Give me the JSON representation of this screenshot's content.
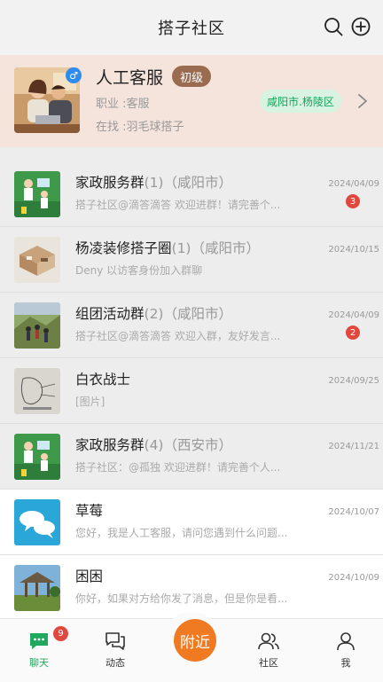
{
  "header": {
    "title": "搭子社区",
    "search_icon": "search-icon",
    "add_icon": "plus-circle-icon"
  },
  "profile": {
    "name": "人工客服",
    "level": "初级",
    "gender_icon": "male-icon",
    "job": "职业 :客服",
    "seeking": "在找 :羽毛球搭子",
    "location": "咸阳市.杨陵区"
  },
  "chats": [
    {
      "title": "家政服务群",
      "suffix": "(1)（咸阳市）",
      "message": "搭子社区@滴答滴答 欢迎进群！请完善个...",
      "date": "2024/04/09",
      "badge": "3"
    },
    {
      "title": "杨凌装修搭子圈",
      "suffix": "(1)（咸阳市）",
      "message": "Deny 以访客身份加入群聊",
      "date": "2024/10/15",
      "badge": ""
    },
    {
      "title": "组团活动群",
      "suffix": "(2)（咸阳市）",
      "message": "搭子社区@滴答滴答 欢迎入群，友好发言...",
      "date": "2024/04/09",
      "badge": "2"
    },
    {
      "title": "白衣战士",
      "suffix": "",
      "message": "[图片]",
      "date": "2024/09/25",
      "badge": ""
    },
    {
      "title": "家政服务群",
      "suffix": "(4)（西安市）",
      "message": "搭子社区：@孤独 欢迎进群！请完善个人...",
      "date": "2024/11/21",
      "badge": ""
    },
    {
      "title": "草莓",
      "suffix": "",
      "message": "您好，我是人工客服，请问您遇到什么问题...",
      "date": "2024/10/07",
      "badge": ""
    },
    {
      "title": "困困",
      "suffix": "",
      "message": "你好，如果对方给你发了消息，但是你是看...",
      "date": "2024/10/09",
      "badge": ""
    }
  ],
  "tabs": {
    "chat": "聊天",
    "chat_badge": "9",
    "feed": "动态",
    "nearby": "附近",
    "community": "社区",
    "me": "我"
  },
  "colors": {
    "accent_green": "#20a95e",
    "nearby_orange": "#f07a22",
    "badge_red": "#e0483e",
    "level_brown": "#9a6b4f"
  }
}
